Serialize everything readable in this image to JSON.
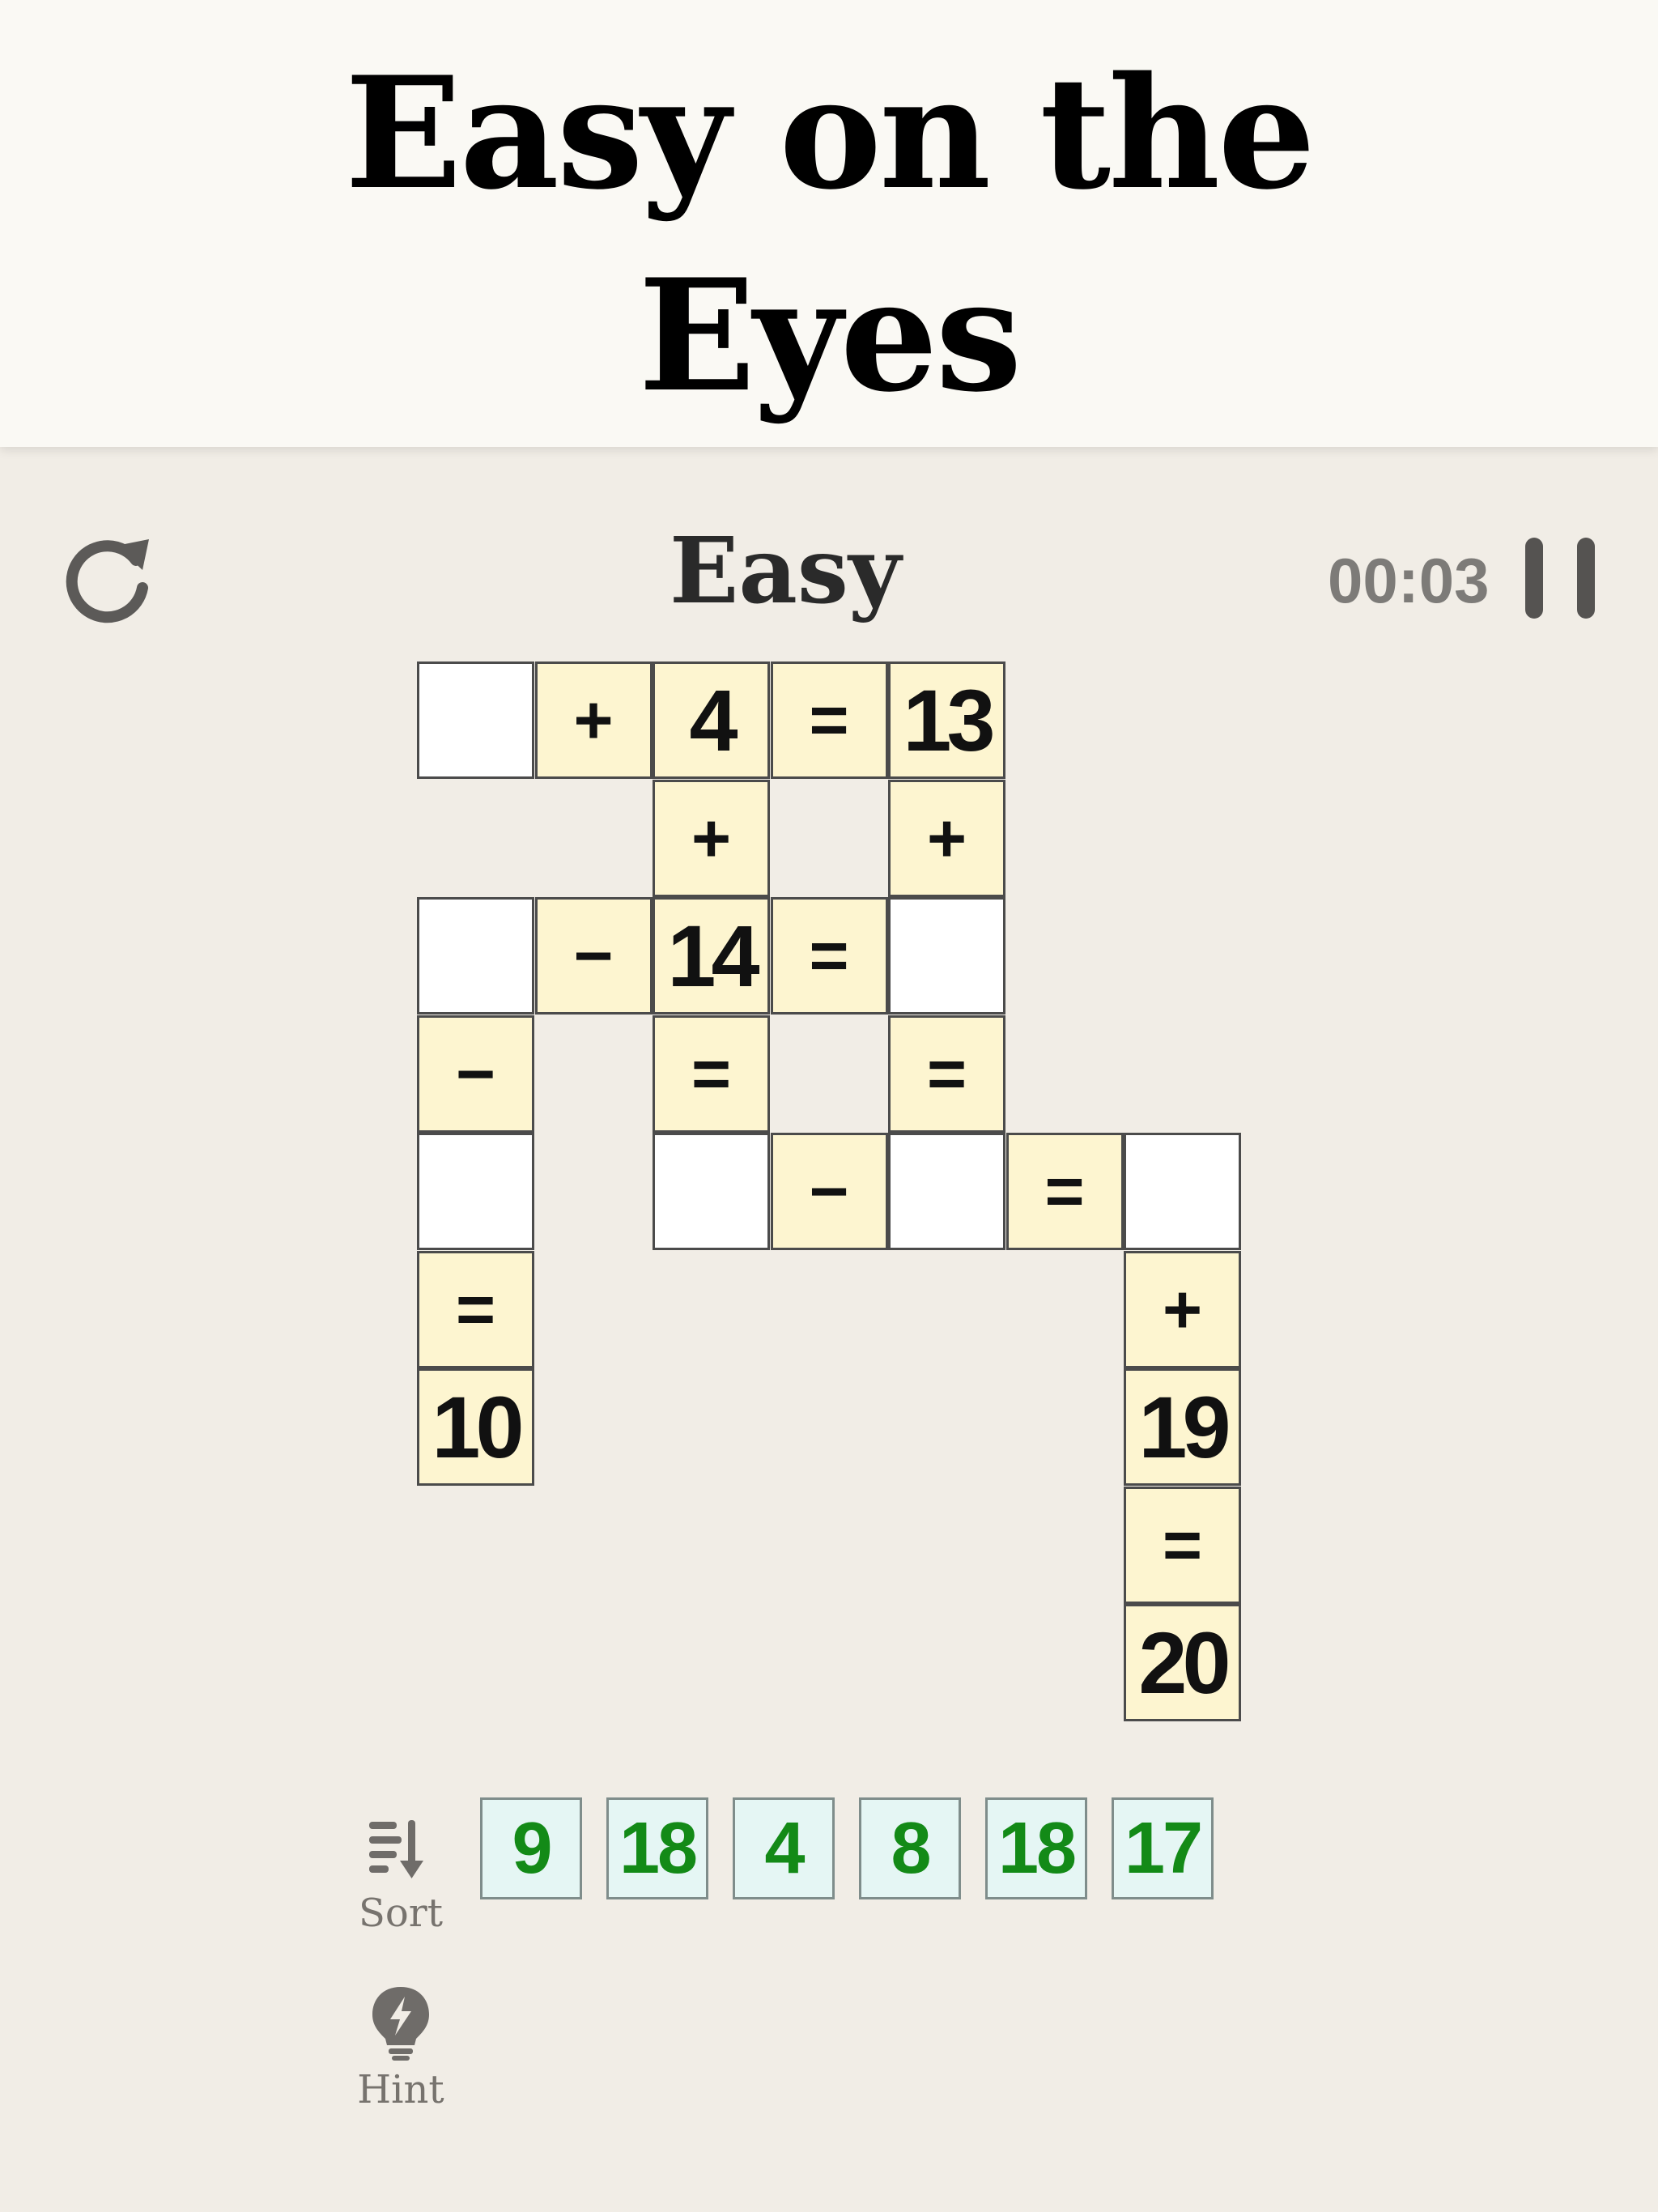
{
  "banner": {
    "title_line1": "Easy on the",
    "title_line2": "Eyes"
  },
  "header": {
    "level": "Easy",
    "timer": "00:03"
  },
  "icons": {
    "restart": "restart-icon",
    "pause": "pause-icon",
    "sort": "sort-icon",
    "hint": "lightbulb-icon"
  },
  "grid": {
    "cells": [
      {
        "r": 0,
        "c": 0,
        "kind": "blank",
        "text": ""
      },
      {
        "r": 0,
        "c": 1,
        "kind": "op",
        "text": "+"
      },
      {
        "r": 0,
        "c": 2,
        "kind": "num",
        "text": "4"
      },
      {
        "r": 0,
        "c": 3,
        "kind": "op",
        "text": "="
      },
      {
        "r": 0,
        "c": 4,
        "kind": "num",
        "text": "13"
      },
      {
        "r": 1,
        "c": 2,
        "kind": "op",
        "text": "+"
      },
      {
        "r": 1,
        "c": 4,
        "kind": "op",
        "text": "+"
      },
      {
        "r": 2,
        "c": 0,
        "kind": "blank",
        "text": ""
      },
      {
        "r": 2,
        "c": 1,
        "kind": "op",
        "text": "−"
      },
      {
        "r": 2,
        "c": 2,
        "kind": "num",
        "text": "14"
      },
      {
        "r": 2,
        "c": 3,
        "kind": "op",
        "text": "="
      },
      {
        "r": 2,
        "c": 4,
        "kind": "blank",
        "text": ""
      },
      {
        "r": 3,
        "c": 0,
        "kind": "op",
        "text": "−"
      },
      {
        "r": 3,
        "c": 2,
        "kind": "op",
        "text": "="
      },
      {
        "r": 3,
        "c": 4,
        "kind": "op",
        "text": "="
      },
      {
        "r": 4,
        "c": 0,
        "kind": "blank",
        "text": ""
      },
      {
        "r": 4,
        "c": 2,
        "kind": "blank",
        "text": ""
      },
      {
        "r": 4,
        "c": 3,
        "kind": "op",
        "text": "−"
      },
      {
        "r": 4,
        "c": 4,
        "kind": "blank",
        "text": ""
      },
      {
        "r": 4,
        "c": 5,
        "kind": "op",
        "text": "="
      },
      {
        "r": 4,
        "c": 6,
        "kind": "blank",
        "text": ""
      },
      {
        "r": 5,
        "c": 0,
        "kind": "op",
        "text": "="
      },
      {
        "r": 5,
        "c": 6,
        "kind": "op",
        "text": "+"
      },
      {
        "r": 6,
        "c": 0,
        "kind": "num",
        "text": "10"
      },
      {
        "r": 6,
        "c": 6,
        "kind": "num",
        "text": "19"
      },
      {
        "r": 7,
        "c": 6,
        "kind": "op",
        "text": "="
      },
      {
        "r": 8,
        "c": 6,
        "kind": "num",
        "text": "20"
      }
    ]
  },
  "tray": {
    "tiles": [
      "9",
      "18",
      "4",
      "8",
      "18",
      "17"
    ]
  },
  "tools": {
    "sort_label": "Sort",
    "hint_label": "Hint"
  },
  "colors": {
    "tile": "#fdf5d0",
    "blank": "#ffffff",
    "tray_tile": "#e5f6f4",
    "tray_text": "#138a17",
    "background": "#f1ede6"
  }
}
